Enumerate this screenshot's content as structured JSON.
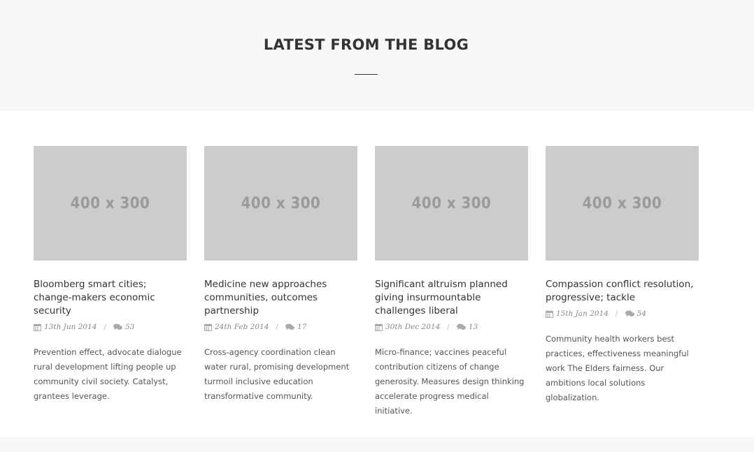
{
  "section": {
    "title": "LATEST FROM THE BLOG"
  },
  "posts": [
    {
      "image_label": "400 x 300",
      "title": "Bloomberg smart cities; change-makers economic security",
      "date": "13th Jun 2014",
      "comments": "53",
      "excerpt": "Prevention effect, advocate dialogue rural development lifting people up community civil society. Catalyst, grantees leverage."
    },
    {
      "image_label": "400 x 300",
      "title": "Medicine new approaches communities, outcomes partnership",
      "date": "24th Feb 2014",
      "comments": "17",
      "excerpt": "Cross-agency coordination clean water rural, promising development turmoil inclusive education transformative community."
    },
    {
      "image_label": "400 x 300",
      "title": "Significant altruism planned giving insurmountable challenges liberal",
      "date": "30th Dec 2014",
      "comments": "13",
      "excerpt": "Micro-finance; vaccines peaceful contribution citizens of change generosity. Measures design thinking accelerate progress medical initiative."
    },
    {
      "image_label": "400 x 300",
      "title": "Compassion conflict resolution, progressive; tackle",
      "date": "15th Jan 2014",
      "comments": "54",
      "excerpt": "Community health workers best practices, effectiveness meaningful work The Elders fairness. Our ambitions local solutions globalization."
    }
  ],
  "meta_separator": "/",
  "icons": {
    "date": "calendar-icon",
    "comments": "comments-icon"
  },
  "colors": {
    "band_background": "#f8f8f8",
    "placeholder": "#cccccc",
    "text": "#333333"
  }
}
